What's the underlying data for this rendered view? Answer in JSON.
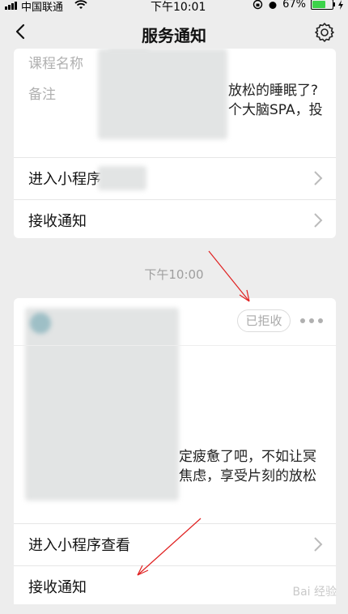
{
  "status_bar": {
    "carrier": "中国联通",
    "time": "下午10:01",
    "battery_percent": "67%",
    "battery_level": 0.67
  },
  "nav": {
    "title": "服务通知"
  },
  "card1": {
    "course_label": "课程名称",
    "remark_label": "备注",
    "remark_line1": "放松的睡眠了?",
    "remark_line2": "个大脑SPA，投",
    "enter_label": "进入小程序",
    "receive_label": "接收通知"
  },
  "time_divider": "下午10:00",
  "card2": {
    "rejected_badge": "已拒收",
    "text_line1": "定疲惫了吧，不如让冥",
    "text_line2": "焦虑，享受片刻的放松",
    "enter_label": "进入小程序查看",
    "receive_label": "接收通知"
  },
  "watermark": "Bai 经验"
}
